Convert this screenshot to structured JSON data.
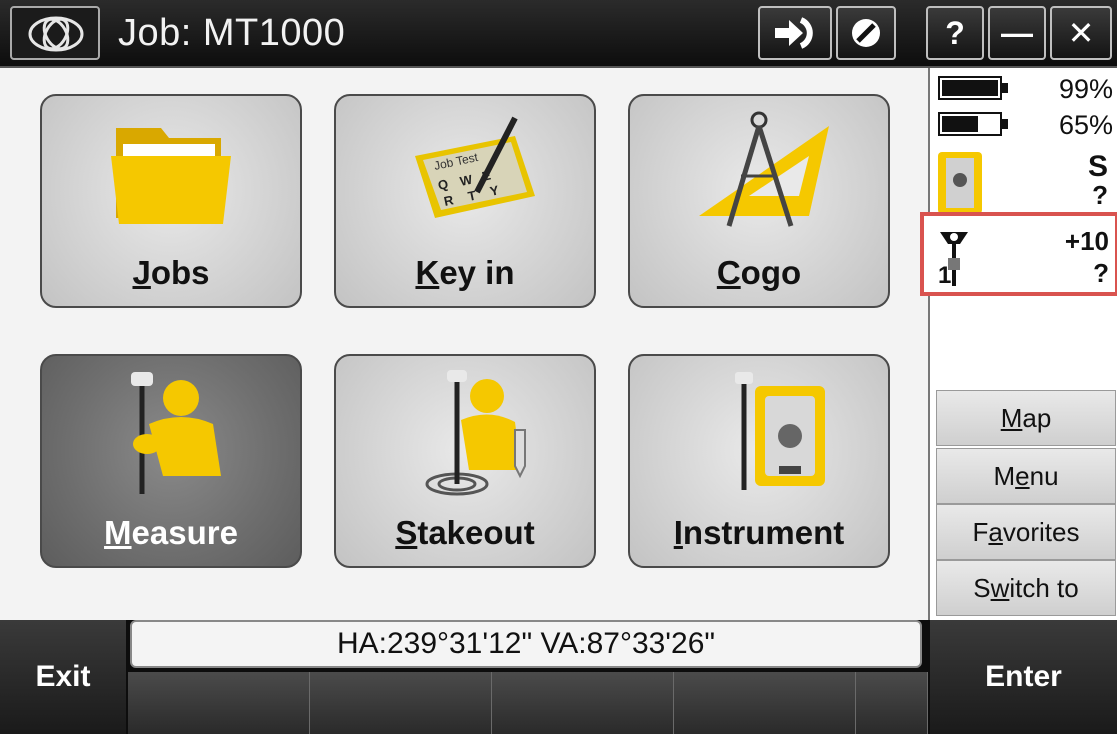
{
  "titlebar": {
    "title": "Job: MT1000",
    "logo_icon": "trimble-globe-icon",
    "buttons": {
      "arrow_icon": "arrow-right-icon",
      "cancel_icon": "cancel-circle-icon",
      "help_label": "?",
      "minimize_label": "—",
      "close_label": "✕"
    }
  },
  "tiles": [
    {
      "pre": "",
      "u": "J",
      "post": "obs",
      "icon": "folder-icon"
    },
    {
      "pre": "",
      "u": "K",
      "post": "ey in",
      "icon": "keypad-pen-icon"
    },
    {
      "pre": "",
      "u": "C",
      "post": "ogo",
      "icon": "compass-triangle-icon"
    },
    {
      "pre": "",
      "u": "M",
      "post": "easure",
      "icon": "surveyor-gnss-icon",
      "active": true
    },
    {
      "pre": "",
      "u": "S",
      "post": "takeout",
      "icon": "surveyor-stakeout-icon"
    },
    {
      "pre": "",
      "u": "I",
      "post": "nstrument",
      "icon": "total-station-icon"
    }
  ],
  "status": {
    "battery1": "99%",
    "battery2": "65%",
    "instrument_s": "S",
    "instrument_q": "?",
    "gnss_offset": "+10",
    "gnss_q": "?",
    "gnss_sats": "1"
  },
  "side_buttons": [
    {
      "pre": "",
      "u": "M",
      "post": "ap"
    },
    {
      "pre": "M",
      "u": "e",
      "post": "nu"
    },
    {
      "pre": "F",
      "u": "a",
      "post": "vorites"
    },
    {
      "pre": "S",
      "u": "w",
      "post": "itch to"
    }
  ],
  "bottom": {
    "exit_label": "Exit",
    "enter_label": "Enter",
    "angles": "HA:239°31'12\"  VA:87°33'26\""
  },
  "colors": {
    "highlight_border": "#d9534f",
    "accent_yellow": "#f5c800"
  }
}
